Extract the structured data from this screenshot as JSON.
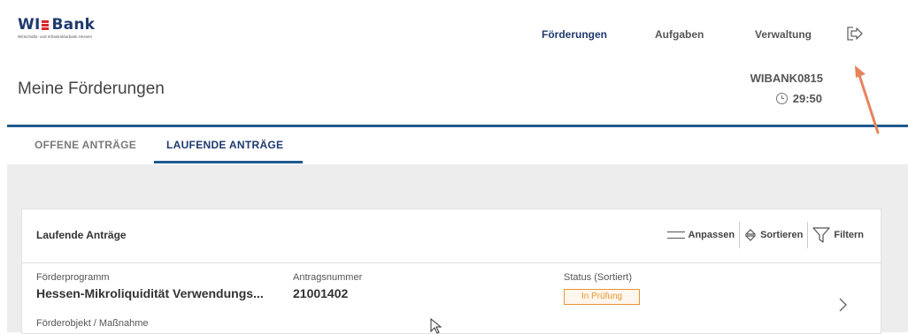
{
  "brand": {
    "name_left": "WI",
    "name_right": "Bank",
    "tagline": "Wirtschafts- und Infrastrukturbank Hessen"
  },
  "nav": {
    "items": [
      {
        "label": "Förderungen",
        "active": true
      },
      {
        "label": "Aufgaben",
        "active": false
      },
      {
        "label": "Verwaltung",
        "active": false
      }
    ],
    "logout_icon": "logout-icon"
  },
  "page": {
    "title": "Meine Förderungen",
    "user_id": "WIBANK0815",
    "session_timer": "29:50"
  },
  "tabs": [
    {
      "label": "OFFENE ANTRÄGE",
      "active": false
    },
    {
      "label": "LAUFENDE ANTRÄGE",
      "active": true
    }
  ],
  "card": {
    "title": "Laufende Anträge",
    "tools": {
      "adjust": "Anpassen",
      "sort": "Sortieren",
      "filter": "Filtern"
    },
    "row": {
      "program_label": "Förderprogramm",
      "program_value": "Hessen-Mikroliquidität Verwendungs...",
      "number_label": "Antragsnummer",
      "number_value": "21001402",
      "status_label": "Status (Sortiert)",
      "status_value": "In Prüfung",
      "object_label": "Förderobjekt / Maßnahme"
    }
  },
  "colors": {
    "brand_blue": "#1f3a6e",
    "rule_blue": "#1e5a8f",
    "status_orange": "#e8952f",
    "annotation_arrow": "#e8835c"
  }
}
